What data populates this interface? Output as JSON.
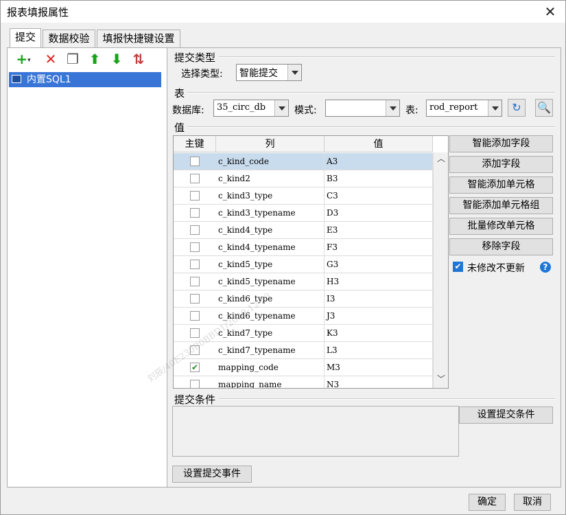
{
  "dialog": {
    "title": "报表填报属性"
  },
  "tabs": [
    {
      "label": "提交"
    },
    {
      "label": "数据校验"
    },
    {
      "label": "填报快捷键设置"
    }
  ],
  "toolbar": {
    "icons": [
      "add-dropdown-icon",
      "delete-icon",
      "copy-icon",
      "move-up-icon",
      "move-down-icon",
      "sort-icon"
    ],
    "add_glyph": "+",
    "delete_glyph": "✕",
    "copy_glyph": "❐",
    "up_glyph": "⬆",
    "down_glyph": "⬇",
    "sort_glyph": "⇅"
  },
  "tree": {
    "items": [
      {
        "label": "内置SQL1"
      }
    ]
  },
  "submit_type": {
    "group_label": "提交类型",
    "select_label": "选择类型:",
    "value": "智能提交"
  },
  "table_group": {
    "group_label": "表",
    "db_label": "数据库:",
    "db_value": "35_circ_db",
    "schema_label": "模式:",
    "schema_value": "",
    "table_label": "表:",
    "table_value": "rod_report"
  },
  "values_group": {
    "group_label": "值",
    "headers": {
      "key": "主键",
      "column": "列",
      "value": "值"
    },
    "rows": [
      {
        "key": false,
        "column": "c_kind_code",
        "value": "A3"
      },
      {
        "key": false,
        "column": "c_kind2",
        "value": "B3"
      },
      {
        "key": false,
        "column": "c_kind3_type",
        "value": "C3"
      },
      {
        "key": false,
        "column": "c_kind3_typename",
        "value": "D3"
      },
      {
        "key": false,
        "column": "c_kind4_type",
        "value": "E3"
      },
      {
        "key": false,
        "column": "c_kind4_typename",
        "value": "F3"
      },
      {
        "key": false,
        "column": "c_kind5_type",
        "value": "G3"
      },
      {
        "key": false,
        "column": "c_kind5_typename",
        "value": "H3"
      },
      {
        "key": false,
        "column": "c_kind6_type",
        "value": "I3"
      },
      {
        "key": false,
        "column": "c_kind6_typename",
        "value": "J3"
      },
      {
        "key": false,
        "column": "c_kind7_type",
        "value": "K3"
      },
      {
        "key": false,
        "column": "c_kind7_typename",
        "value": "L3"
      },
      {
        "key": true,
        "column": "mapping_code",
        "value": "M3"
      },
      {
        "key": false,
        "column": "mapping_name",
        "value": "N3"
      }
    ],
    "buttons": {
      "smart_add_field": "智能添加字段",
      "add_field": "添加字段",
      "smart_add_cell": "智能添加单元格",
      "smart_add_cell_group": "智能添加单元格组",
      "batch_edit_cell": "批量修改单元格",
      "remove_field": "移除字段"
    },
    "no_update_label": "未修改不更新",
    "no_update_checked": true
  },
  "condition_group": {
    "group_label": "提交条件",
    "set_condition": "设置提交条件"
  },
  "set_event": "设置提交事件",
  "footer": {
    "ok": "确定",
    "cancel": "取消"
  },
  "watermark": "刘辰/40E230B0BBD1/2020-12-03",
  "colors": {
    "selection": "#3875d7",
    "row_selected": "#c9dcee",
    "accent": "#1e76d6"
  }
}
